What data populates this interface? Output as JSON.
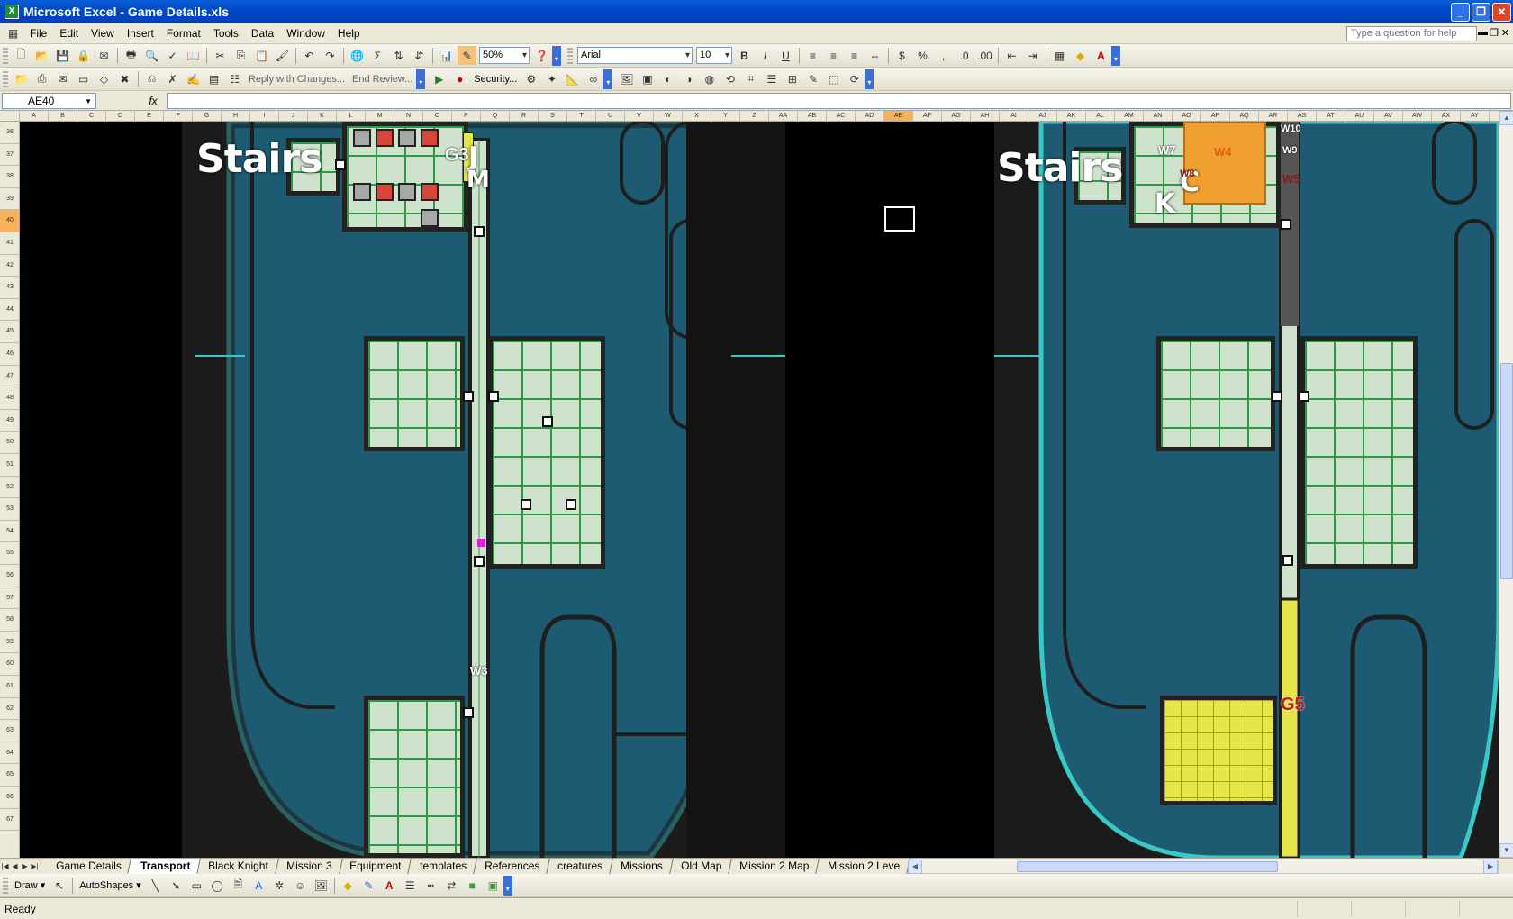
{
  "window": {
    "title": "Microsoft Excel - Game Details.xls",
    "icon": "excel-app-icon"
  },
  "menu": {
    "items": [
      "File",
      "Edit",
      "View",
      "Insert",
      "Format",
      "Tools",
      "Data",
      "Window",
      "Help"
    ],
    "help_placeholder": "Type a question for help"
  },
  "toolbar": {
    "zoom": "50%",
    "font": "Arial",
    "font_size": "10",
    "bold": "B",
    "italic": "I",
    "underline": "U",
    "reply_changes": "Reply with Changes...",
    "end_review": "End Review...",
    "security": "Security..."
  },
  "formula": {
    "cell_ref": "AE40",
    "fx": "fx",
    "value": ""
  },
  "columns": [
    "A",
    "B",
    "C",
    "D",
    "E",
    "F",
    "G",
    "H",
    "I",
    "J",
    "K",
    "L",
    "M",
    "N",
    "O",
    "P",
    "Q",
    "R",
    "S",
    "T",
    "U",
    "V",
    "W",
    "X",
    "Y",
    "Z",
    "AA",
    "AB",
    "AC",
    "AD",
    "AE",
    "AF",
    "AG",
    "AH",
    "AI",
    "AJ",
    "AK",
    "AL",
    "AM",
    "AN",
    "AO",
    "AP",
    "AQ",
    "AR",
    "AS",
    "AT",
    "AU",
    "AV",
    "AW",
    "AX",
    "AY"
  ],
  "selected_column": "AE",
  "rows": [
    "36",
    "37",
    "38",
    "39",
    "40",
    "41",
    "42",
    "43",
    "44",
    "45",
    "46",
    "47",
    "48",
    "49",
    "50",
    "51",
    "52",
    "53",
    "54",
    "55",
    "56",
    "57",
    "58",
    "59",
    "60",
    "61",
    "62",
    "63",
    "64",
    "65",
    "66",
    "67"
  ],
  "selected_row": "40",
  "map": {
    "left_stairs": "Stairs",
    "right_stairs": "Stairs",
    "left_letters": [
      "J",
      "M"
    ],
    "left_labels": [
      "G3",
      "W3"
    ],
    "right_letters": [
      "C",
      "K"
    ],
    "right_labels": [
      "W7",
      "W4",
      "W5",
      "W8",
      "W9",
      "W10",
      "G5"
    ],
    "colors": {
      "teal": "#1d5b72",
      "orange": "#f0a030",
      "yellow": "#e6e64a",
      "red": "#d8463a",
      "grey": "#a6aaa6",
      "magenta": "#e020d8"
    }
  },
  "tabs": [
    "Game Details",
    "Transport",
    "Black Knight",
    "Mission 3",
    "Equipment",
    "templates",
    "References",
    "creatures",
    "Missions",
    "Old Map",
    "Mission 2 Map",
    "Mission 2 Leve"
  ],
  "active_tab": "Transport",
  "drawbar": {
    "draw": "Draw ▾",
    "autoshapes": "AutoShapes ▾"
  },
  "status": {
    "text": "Ready"
  }
}
